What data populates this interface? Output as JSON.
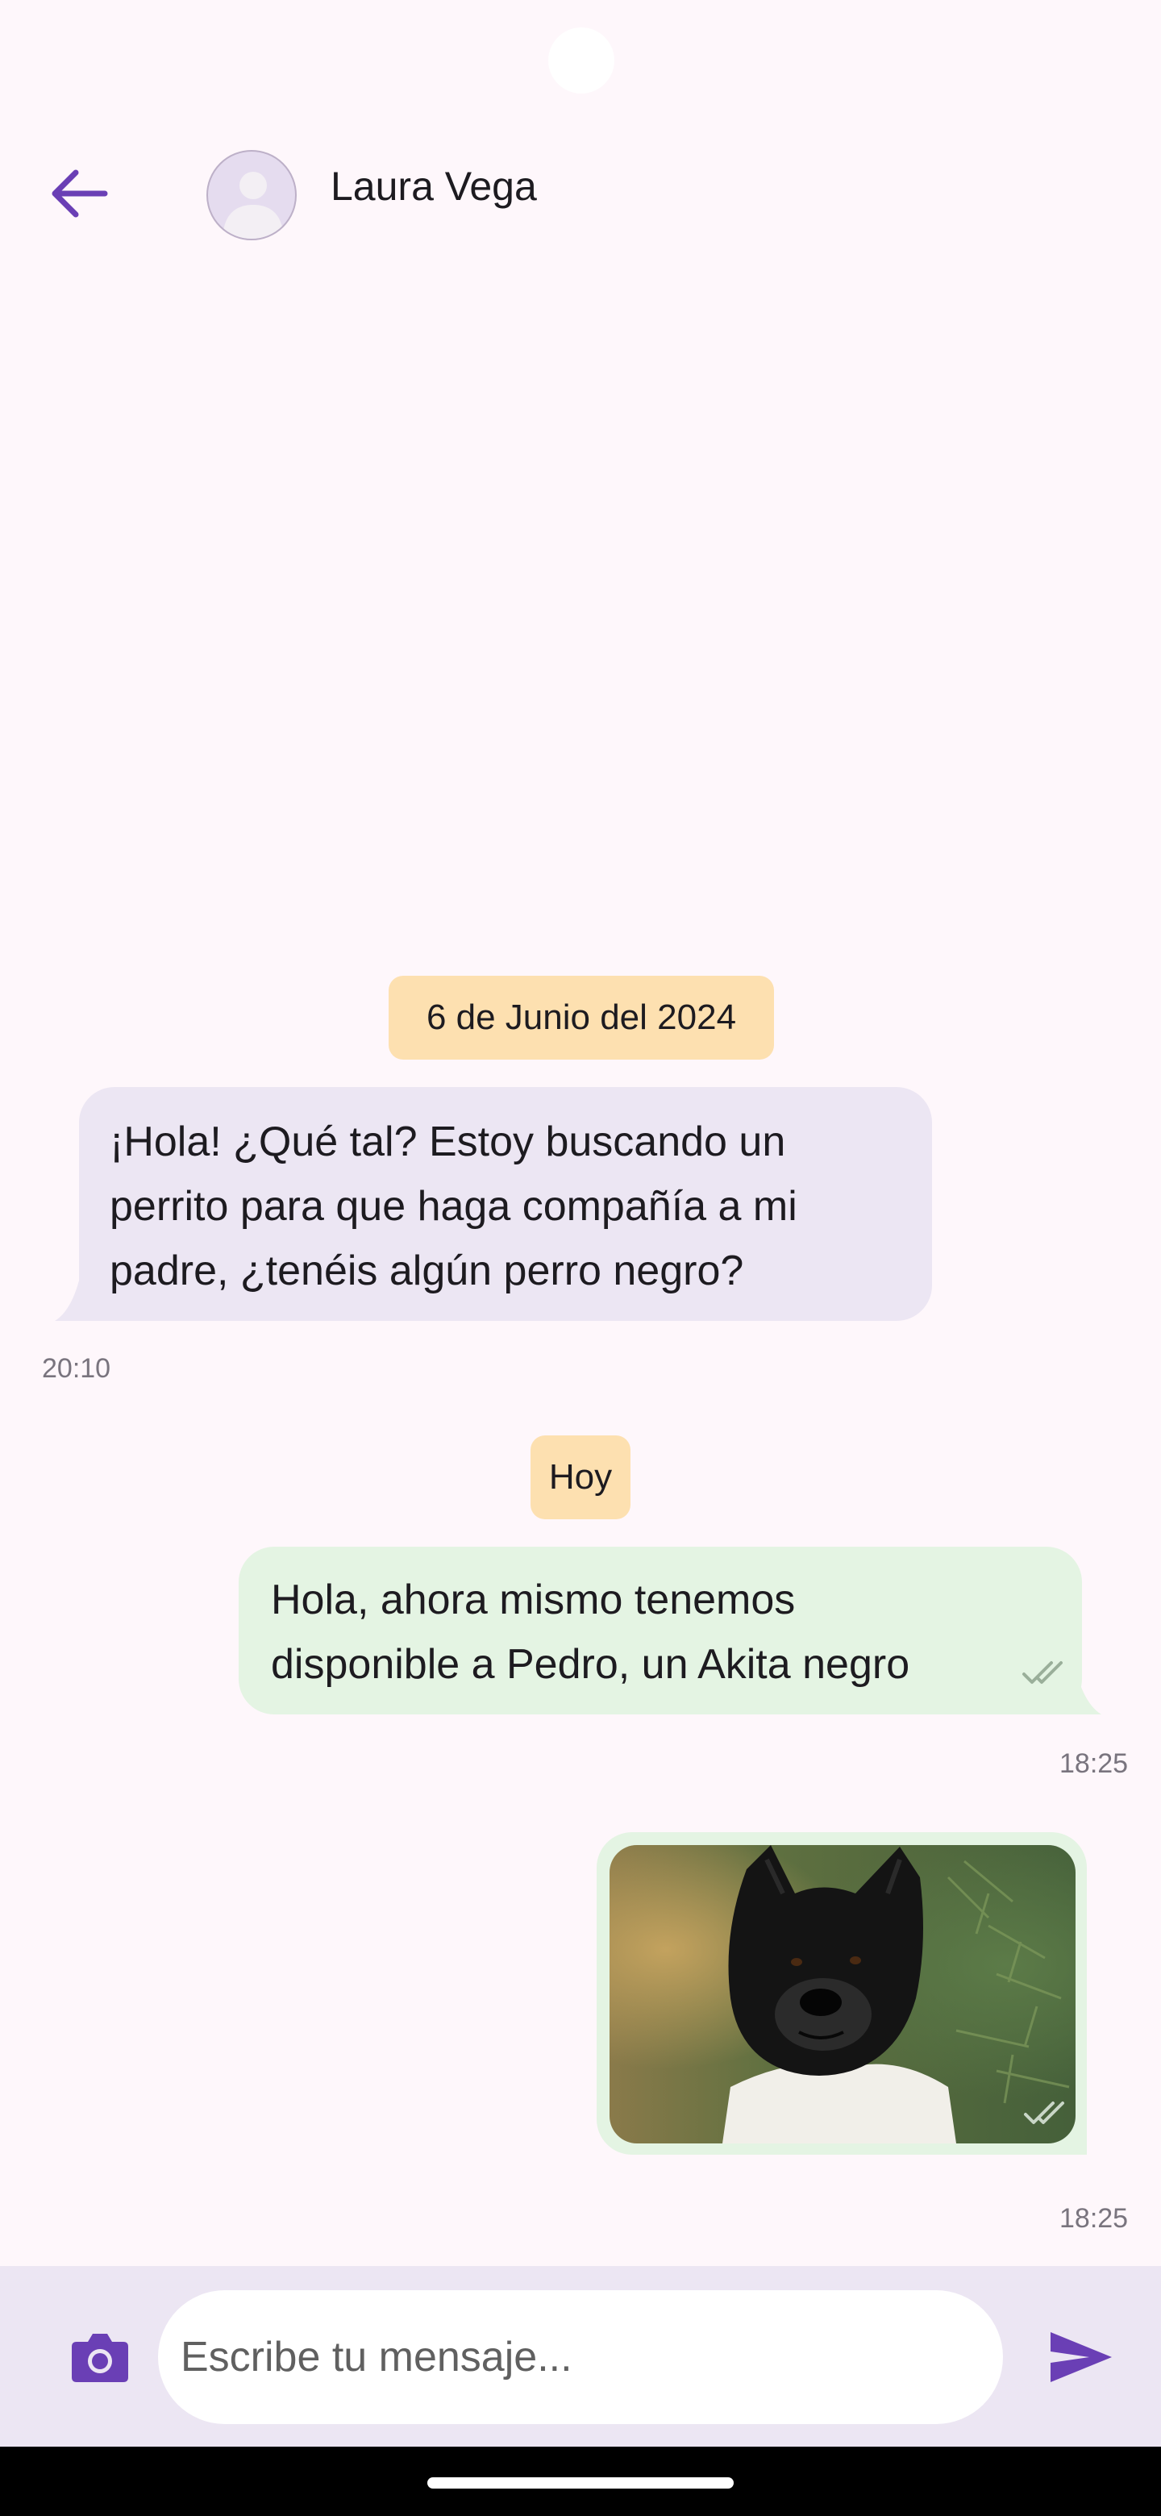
{
  "header": {
    "contact_name": "Laura Vega",
    "back_icon": "arrow-back-icon",
    "avatar_icon": "person-placeholder-icon"
  },
  "messages": {
    "date_chip_1": "6 de Junio del 2024",
    "incoming": {
      "lines": [
        "¡Hola! ¿Qué tal? Estoy buscando un",
        "perrito para que haga compañía a mi",
        "padre, ¿tenéis algún perro negro?"
      ],
      "time": "20:10"
    },
    "date_chip_2": "Hoy",
    "outgoing_text": {
      "lines": [
        "Hola, ahora mismo tenemos",
        "disponible a Pedro, un Akita negro"
      ],
      "time": "18:25",
      "status_icon": "double-check-icon"
    },
    "outgoing_image": {
      "subject": "black Akita dog photo",
      "time": "18:25",
      "status_icon": "double-check-icon"
    }
  },
  "composer": {
    "placeholder": "Escribe tu mensaje...",
    "camera_icon": "camera-icon",
    "send_icon": "send-icon"
  },
  "colors": {
    "accent": "#6a3fb5",
    "incoming_bubble": "#ece6f3",
    "outgoing_bubble": "#e4f4e3",
    "date_chip": "#fde0b0",
    "background": "#fef7fb"
  }
}
